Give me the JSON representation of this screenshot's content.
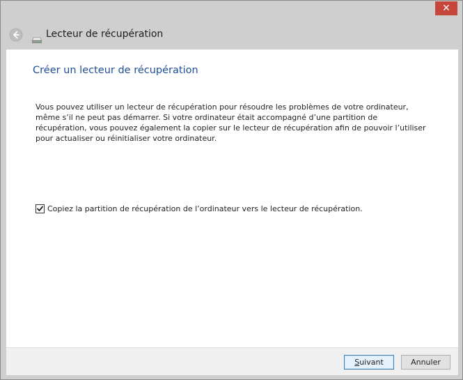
{
  "window": {
    "close_glyph": "✕",
    "accent_close": "#c7463c"
  },
  "nav": {
    "back_icon": "back-arrow-icon",
    "drive_icon": "drive-icon",
    "title": "Lecteur de récupération"
  },
  "content": {
    "heading": "Créer un lecteur de récupération",
    "heading_color": "#1d4f98",
    "description_lines": [
      "Vous pouvez utiliser un lecteur de récupération pour résoudre les problèmes de votre ordinateur,",
      "même s’il ne peut pas démarrer. Si votre ordinateur était accompagné d’une partition de",
      "récupération, vous pouvez également la copier sur le lecteur de récupération afin de pouvoir l’utiliser",
      "pour actualiser ou réinitialiser votre ordinateur."
    ],
    "checkbox": {
      "checked": true,
      "label": "Copiez la partition de récupération de l’ordinateur vers le lecteur de récupération."
    }
  },
  "footer": {
    "next_label": "Suivant",
    "cancel_label": "Annuler"
  }
}
